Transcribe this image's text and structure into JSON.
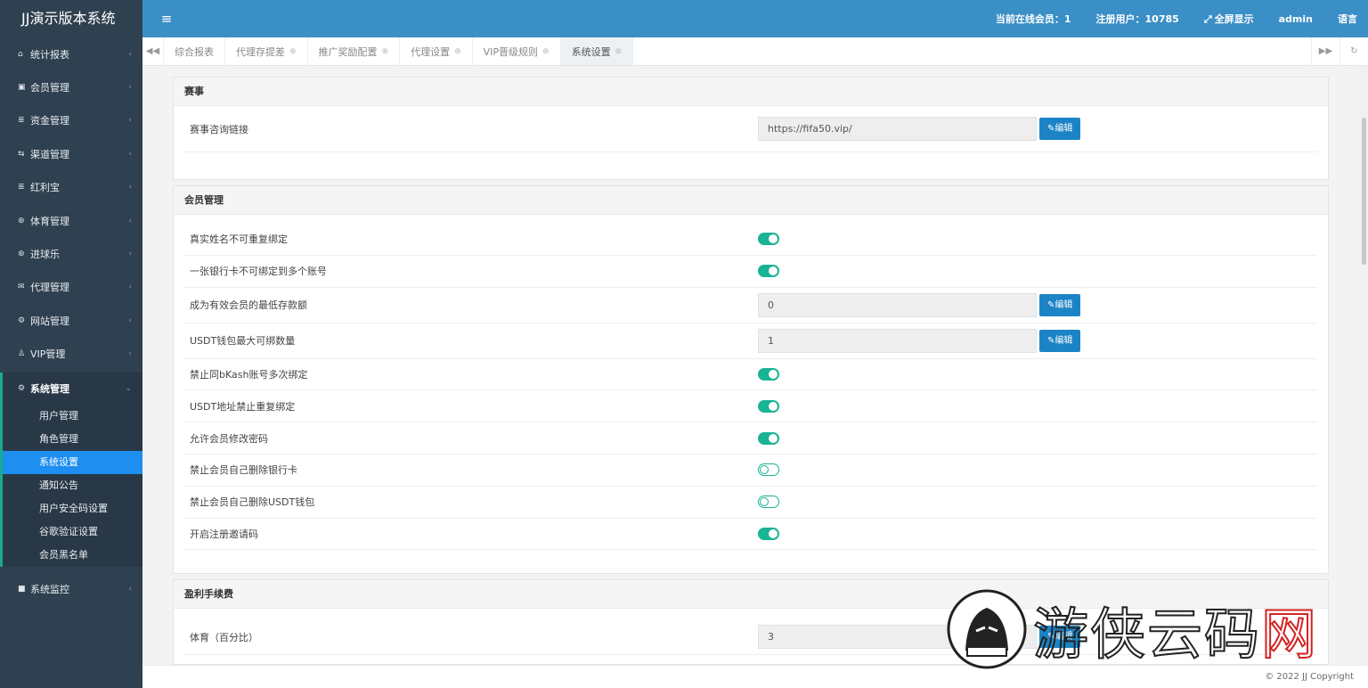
{
  "brand": "JJ演示版本系统",
  "topbar": {
    "online": "当前在线会员：1",
    "registered": "注册用户：10785",
    "fullscreen": "全屏显示",
    "user": "admin",
    "language": "语言"
  },
  "sidebar": {
    "items": [
      {
        "label": "统计报表",
        "icon": "home-icon"
      },
      {
        "label": "会员管理",
        "icon": "member-icon"
      },
      {
        "label": "资金管理",
        "icon": "database-icon"
      },
      {
        "label": "渠道管理",
        "icon": "channel-icon"
      },
      {
        "label": "红利宝",
        "icon": "database-icon"
      },
      {
        "label": "体育管理",
        "icon": "ball-icon"
      },
      {
        "label": "进球乐",
        "icon": "ball-icon"
      },
      {
        "label": "代理管理",
        "icon": "mail-icon"
      },
      {
        "label": "网站管理",
        "icon": "gears-icon"
      },
      {
        "label": "VIP管理",
        "icon": "user-icon"
      }
    ],
    "open_group": {
      "label": "系统管理",
      "icon": "gear-icon"
    },
    "sub_items": [
      "用户管理",
      "角色管理",
      "系统设置",
      "通知公告",
      "用户安全码设置",
      "谷歌验证设置",
      "会员黑名单"
    ],
    "active_sub": "系统设置",
    "bottom_item": {
      "label": "系统监控",
      "icon": "video-icon"
    }
  },
  "tabs": [
    {
      "label": "综合报表",
      "closable": false
    },
    {
      "label": "代理存提差",
      "closable": true
    },
    {
      "label": "推广奖励配置",
      "closable": true
    },
    {
      "label": "代理设置",
      "closable": true
    },
    {
      "label": "VIP晋级规则",
      "closable": true
    },
    {
      "label": "系统设置",
      "closable": true,
      "active": true
    }
  ],
  "edit_label": "编辑",
  "sections": {
    "match": {
      "title": "赛事",
      "link_label": "赛事咨询链接",
      "link_value": "https://fifa50.vip/"
    },
    "member": {
      "title": "会员管理",
      "rows": [
        {
          "label": "真实姓名不可重复绑定",
          "type": "toggle",
          "on": true
        },
        {
          "label": "一张银行卡不可绑定到多个账号",
          "type": "toggle",
          "on": true
        },
        {
          "label": "成为有效会员的最低存款额",
          "type": "input",
          "value": "0"
        },
        {
          "label": "USDT钱包最大可绑数量",
          "type": "input",
          "value": "1"
        },
        {
          "label": "禁止同bKash账号多次绑定",
          "type": "toggle",
          "on": true
        },
        {
          "label": "USDT地址禁止重复绑定",
          "type": "toggle",
          "on": true
        },
        {
          "label": "允许会员修改密码",
          "type": "toggle",
          "on": true
        },
        {
          "label": "禁止会员自己删除银行卡",
          "type": "toggle",
          "on": false
        },
        {
          "label": "禁止会员自己删除USDT钱包",
          "type": "toggle",
          "on": false
        },
        {
          "label": "开启注册邀请码",
          "type": "toggle",
          "on": true
        }
      ]
    },
    "profit": {
      "title": "盈利手续费",
      "rows": [
        {
          "label": "体育（百分比）",
          "value": "3"
        }
      ]
    }
  },
  "footer": "© 2022 JJ Copyright",
  "watermark": "游侠云码网",
  "colors": {
    "sidebar": "#2f4050",
    "topbar": "#3a8fc6",
    "toggle": "#1ab394",
    "button": "#1c84c6",
    "active_sub": "#1e8ef0"
  }
}
